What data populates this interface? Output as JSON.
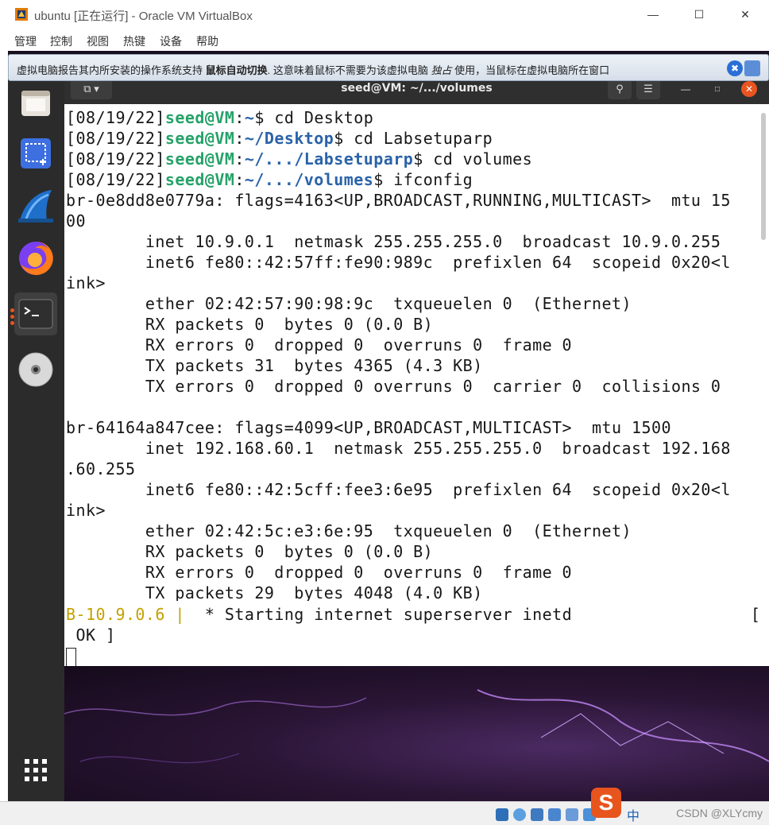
{
  "vbox": {
    "title": "ubuntu [正在运行] - Oracle VM VirtualBox",
    "menus": [
      "管理",
      "控制",
      "视图",
      "热键",
      "设备",
      "帮助"
    ],
    "info_before": "虚拟电脑报告其内所安装的操作系统支持 ",
    "info_bold": "鼠标自动切换",
    "info_mid": ". 这意味着鼠标不需要为该虚拟电脑 ",
    "info_italic": "独占",
    "info_after": " 使用，当鼠标在虚拟电脑所在窗口"
  },
  "terminal": {
    "title": "seed@VM: ~/.../volumes",
    "lines": [
      {
        "date": "[08/19/22]",
        "user": "seed@VM",
        "path": "~",
        "sym": "$",
        "cmd": " cd Desktop"
      },
      {
        "date": "[08/19/22]",
        "user": "seed@VM",
        "path": "~/Desktop",
        "sym": "$",
        "cmd": " cd Labsetuparp"
      },
      {
        "date": "[08/19/22]",
        "user": "seed@VM",
        "path": "~/.../Labsetuparp",
        "sym": "$",
        "cmd": " cd volumes"
      },
      {
        "date": "[08/19/22]",
        "user": "seed@VM",
        "path": "~/.../volumes",
        "sym": "$",
        "cmd": " ifconfig"
      }
    ],
    "output": [
      "br-0e8dd8e0779a: flags=4163<UP,BROADCAST,RUNNING,MULTICAST>  mtu 15",
      "00",
      "        inet 10.9.0.1  netmask 255.255.255.0  broadcast 10.9.0.255",
      "        inet6 fe80::42:57ff:fe90:989c  prefixlen 64  scopeid 0x20<l",
      "ink>",
      "        ether 02:42:57:90:98:9c  txqueuelen 0  (Ethernet)",
      "        RX packets 0  bytes 0 (0.0 B)",
      "        RX errors 0  dropped 0  overruns 0  frame 0",
      "        TX packets 31  bytes 4365 (4.3 KB)",
      "        TX errors 0  dropped 0 overruns 0  carrier 0  collisions 0",
      "",
      "br-64164a847cee: flags=4099<UP,BROADCAST,MULTICAST>  mtu 1500",
      "        inet 192.168.60.1  netmask 255.255.255.0  broadcast 192.168",
      ".60.255",
      "        inet6 fe80::42:5cff:fee3:6e95  prefixlen 64  scopeid 0x20<l",
      "ink>",
      "        ether 02:42:5c:e3:6e:95  txqueuelen 0  (Ethernet)",
      "        RX packets 0  bytes 0 (0.0 B)",
      "        RX errors 0  dropped 0  overruns 0  frame 0",
      "        TX packets 29  bytes 4048 (4.0 KB)"
    ]
  },
  "pane2": {
    "prefix": "B-10.9.0.6 |",
    "text": "  * Starting internet superserver inetd                  [",
    "line2": " OK ]"
  },
  "statusbar": {
    "ime": "中",
    "watermark": "CSDN @XLYcmy"
  },
  "colors": {
    "prompt_user": "#26a269",
    "prompt_path": "#2a63a8",
    "dock": "#2b2b2b",
    "term_header": "#2f2f2f"
  }
}
